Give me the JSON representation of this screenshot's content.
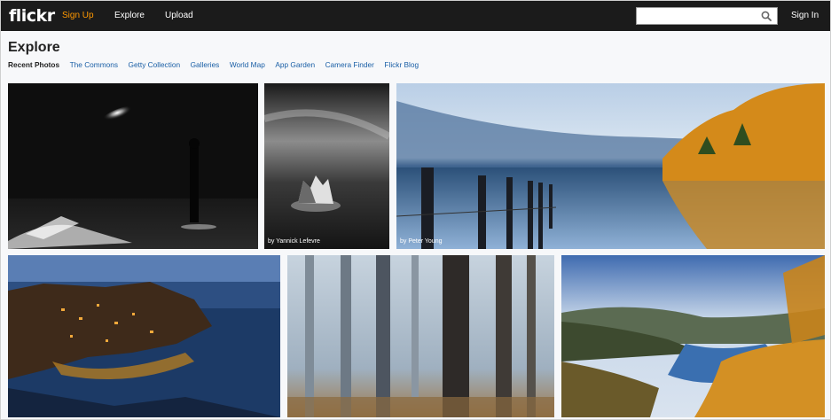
{
  "topbar": {
    "logo": "flickr",
    "nav": {
      "sign_up": "Sign Up",
      "explore": "Explore",
      "upload": "Upload"
    },
    "search": {
      "value": "",
      "placeholder": "",
      "icon": "search-icon"
    },
    "sign_in": "Sign In"
  },
  "page": {
    "title": "Explore",
    "tabs": [
      {
        "label": "Recent Photos",
        "active": true
      },
      {
        "label": "The Commons"
      },
      {
        "label": "Getty Collection"
      },
      {
        "label": "Galleries"
      },
      {
        "label": "World Map"
      },
      {
        "label": "App Garden"
      },
      {
        "label": "Camera Finder"
      },
      {
        "label": "Flickr Blog"
      }
    ]
  },
  "photos": [
    {
      "subject": "night-light-silhouette",
      "credit": ""
    },
    {
      "subject": "rock-in-water",
      "credit": "by Yannick Lefevre"
    },
    {
      "subject": "lake-autumn-posts",
      "credit": "by Peter Young"
    },
    {
      "subject": "coastal-town-night",
      "credit": ""
    },
    {
      "subject": "misty-forest",
      "credit": ""
    },
    {
      "subject": "river-valley-autumn",
      "credit": ""
    }
  ],
  "colors": {
    "topbar": "#1b1b1b",
    "accent": "#ff9800",
    "link": "#1a5fa6"
  }
}
